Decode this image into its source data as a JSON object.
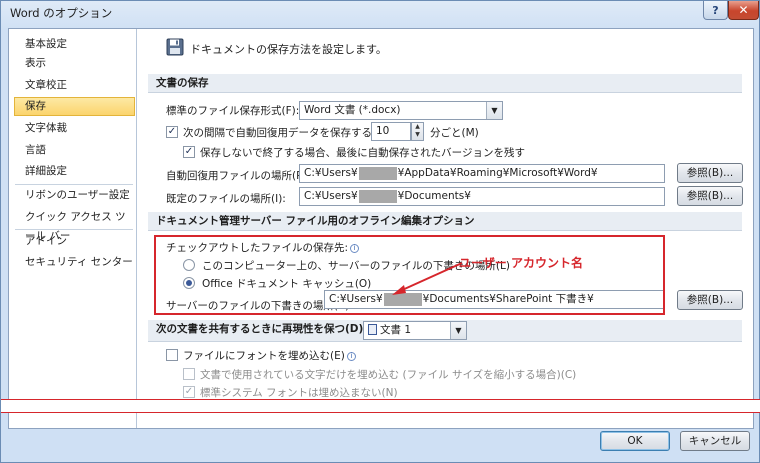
{
  "window": {
    "title": "Word のオプション",
    "help_glyph": "?",
    "close_glyph": "✕"
  },
  "sidebar": {
    "items": [
      {
        "label": "基本設定"
      },
      {
        "label": "表示"
      },
      {
        "label": "文章校正"
      },
      {
        "label": "保存"
      },
      {
        "label": "文字体裁"
      },
      {
        "label": "言語"
      },
      {
        "label": "詳細設定"
      },
      {
        "label": "リボンのユーザー設定"
      },
      {
        "label": "クイック アクセス ツール バー"
      },
      {
        "label": "アドイン"
      },
      {
        "label": "セキュリティ センター"
      }
    ],
    "active_index": 3
  },
  "main": {
    "header": "ドキュメントの保存方法を設定します。",
    "save_docs": {
      "heading": "文書の保存",
      "format_label": "標準のファイル保存形式(F):",
      "format_value": "Word 文書 (*.docx)",
      "autorecover_label": "次の間隔で自動回復用データを保存する(A):",
      "autorecover_minutes": "10",
      "minutes_unit": "分ごと(M)",
      "keep_last_label": "保存しないで終了する場合、最後に自動保存されたバージョンを残す",
      "autorecover_path_label": "自動回復用ファイルの場所(R):",
      "autorecover_path_prefix": "C:¥Users¥",
      "autorecover_path_suffix": "¥AppData¥Roaming¥Microsoft¥Word¥",
      "default_path_label": "既定のファイルの場所(I):",
      "default_path_prefix": "C:¥Users¥",
      "default_path_suffix": "¥Documents¥",
      "browse_label": "参照(B)..."
    },
    "offline": {
      "heading": "ドキュメント管理サーバー ファイル用のオフライン編集オプション",
      "checkout_label": "チェックアウトしたファイルの保存先:",
      "option_server_drafts": "このコンピューター上の、サーバーのファイルの下書きの場所(L)",
      "option_office_cache": "Office ドキュメント キャッシュ(O)",
      "selected": "office_cache",
      "drafts_label": "サーバーのファイルの下書きの場所(V):",
      "drafts_path_prefix": "C:¥Users¥",
      "drafts_path_suffix": "¥Documents¥SharePoint 下書き¥",
      "browse_label": "参照(B)..."
    },
    "fidelity": {
      "heading": "次の文書を共有するときに再現性を保つ(D):",
      "doc_value": "文書 1",
      "embed_fonts_label": "ファイルにフォントを埋め込む(E)",
      "embed_used_only_label": "文書で使用されている文字だけを埋め込む (ファイル サイズを縮小する場合)(C)",
      "no_system_fonts_label": "標準システム フォントは埋め込まない(N)"
    }
  },
  "annotation": {
    "text": "ユーザー アカウント名",
    "color": "#d6262c"
  },
  "footer": {
    "ok_label": "OK",
    "cancel_label": "キャンセル"
  },
  "colors": {
    "active_item": "#fbd46d",
    "section_bg": "#e8edf3",
    "accent": "#d6262c"
  }
}
